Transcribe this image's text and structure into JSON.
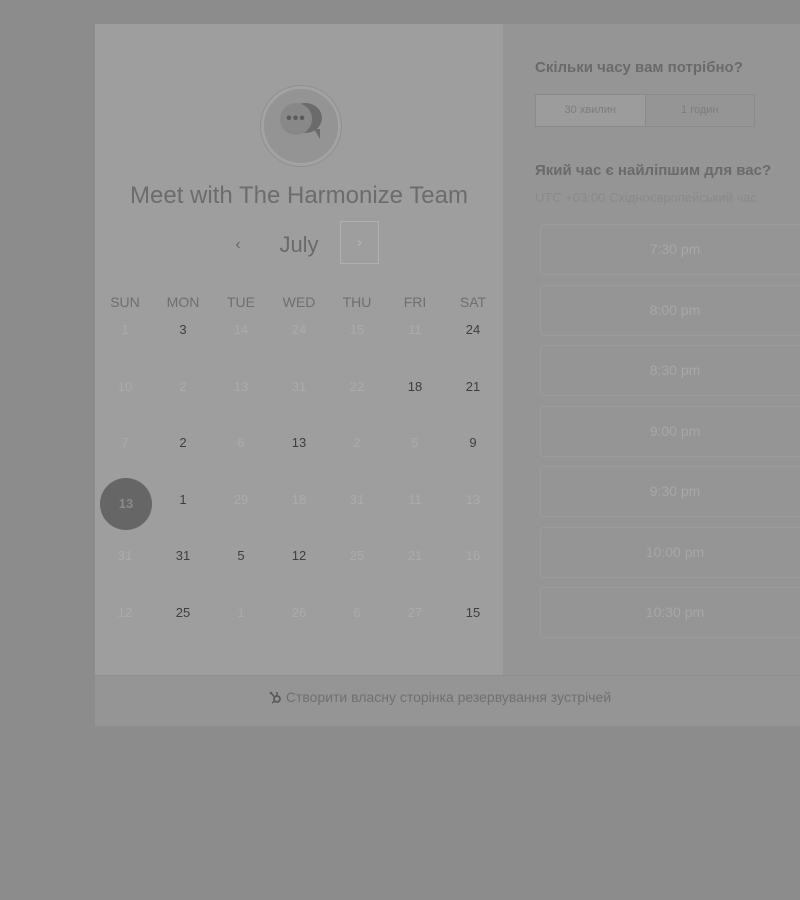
{
  "meeting": {
    "title": "Meet with The Harmonize Team",
    "avatar_icon": "chat-bubble-icon",
    "avatar_glyph": "•••"
  },
  "calendar": {
    "month": "July",
    "prev_glyph": "‹",
    "next_glyph": "›",
    "weekdays": [
      "SUN",
      "MON",
      "TUE",
      "WED",
      "THU",
      "FRI",
      "SAT"
    ],
    "weeks": [
      [
        {
          "d": "1",
          "a": false
        },
        {
          "d": "3",
          "a": true
        },
        {
          "d": "14",
          "a": false
        },
        {
          "d": "24",
          "a": false
        },
        {
          "d": "15",
          "a": false
        },
        {
          "d": "11",
          "a": false
        },
        {
          "d": "24",
          "a": true
        }
      ],
      [
        {
          "d": "10",
          "a": false
        },
        {
          "d": "2",
          "a": false
        },
        {
          "d": "13",
          "a": false
        },
        {
          "d": "31",
          "a": false
        },
        {
          "d": "22",
          "a": false
        },
        {
          "d": "18",
          "a": true
        },
        {
          "d": "21",
          "a": true
        }
      ],
      [
        {
          "d": "7",
          "a": false
        },
        {
          "d": "2",
          "a": true
        },
        {
          "d": "6",
          "a": false
        },
        {
          "d": "13",
          "a": true
        },
        {
          "d": "2",
          "a": false
        },
        {
          "d": "5",
          "a": false
        },
        {
          "d": "9",
          "a": true
        }
      ],
      [
        {
          "d": "13",
          "a": true,
          "selected": true
        },
        {
          "d": "1",
          "a": true
        },
        {
          "d": "29",
          "a": false
        },
        {
          "d": "18",
          "a": false
        },
        {
          "d": "31",
          "a": false
        },
        {
          "d": "11",
          "a": false
        },
        {
          "d": "13",
          "a": false
        }
      ],
      [
        {
          "d": "31",
          "a": false
        },
        {
          "d": "31",
          "a": true
        },
        {
          "d": "5",
          "a": true
        },
        {
          "d": "12",
          "a": true
        },
        {
          "d": "25",
          "a": false
        },
        {
          "d": "21",
          "a": false
        },
        {
          "d": "16",
          "a": false
        }
      ],
      [
        {
          "d": "12",
          "a": false
        },
        {
          "d": "25",
          "a": true
        },
        {
          "d": "1",
          "a": false
        },
        {
          "d": "26",
          "a": false
        },
        {
          "d": "6",
          "a": false
        },
        {
          "d": "27",
          "a": false
        },
        {
          "d": "15",
          "a": true
        }
      ]
    ]
  },
  "duration": {
    "label": "Скільки часу вам потрібно?",
    "options": [
      "30 хвилин",
      "1 годин"
    ],
    "selected_index": 0
  },
  "time": {
    "label": "Який час є найліпшим для вас?",
    "timezone": "UTC +03:00 Східноєвропейський час",
    "slots": [
      "7:30 pm",
      "8:00 pm",
      "8:30 pm",
      "9:00 pm",
      "9:30 pm",
      "10:00 pm",
      "10:30 pm"
    ]
  },
  "footer": {
    "link_text": "Створити власну сторінка резервування зустрічей",
    "icon": "sprocket-icon"
  }
}
